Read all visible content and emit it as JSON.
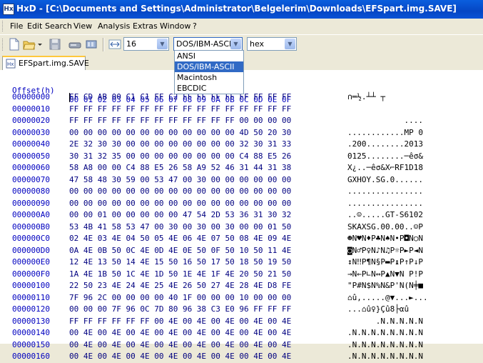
{
  "window": {
    "title": "HxD - [C:\\Documents and Settings\\Administrator\\Belgelerim\\Downloads\\EFSpart.img.SAVE]"
  },
  "menu": [
    "File",
    "Edit",
    "Search",
    "View",
    "Analysis",
    "Extras",
    "Window",
    "?"
  ],
  "toolbar": {
    "bytes_per_row": "16",
    "charset": "DOS/IBM-ASCII",
    "charset_options": [
      "ANSI",
      "DOS/IBM-ASCII",
      "Macintosh",
      "EBCDIC"
    ],
    "charset_selected_index": 1,
    "display_mode": "hex"
  },
  "tab": {
    "label": "EFSpart.img.SAVE"
  },
  "header": {
    "offset_label": "Offset(h)",
    "columns": "00 01 02 03 04 05 06 07 08 09 0A 0B 0C 0D 0E 0F"
  },
  "rows": [
    {
      "offset": "00000000",
      "hex": "EF CD AB 00 C1 C1 FF C2 FF FF FF FF FF FF FF FF",
      "ascii": "∩═½.┴┴ ┬"
    },
    {
      "offset": "00000010",
      "hex": "FF FF FF FF FF FF FF FF FF FF FF FF FF FF FF FF",
      "ascii": ""
    },
    {
      "offset": "00000020",
      "hex": "FF FF FF FF FF FF FF FF FF FF FF FF 00 00 00 00",
      "ascii": "            ...."
    },
    {
      "offset": "00000030",
      "hex": "00 00 00 00 00 00 00 00 00 00 00 00 4D 50 20 30",
      "ascii": "............MP 0"
    },
    {
      "offset": "00000040",
      "hex": "2E 32 30 30 00 00 00 00 00 00 00 00 32 30 31 33",
      "ascii": ".200........2013"
    },
    {
      "offset": "00000050",
      "hex": "30 31 32 35 00 00 00 00 00 00 00 00 C4 88 E5 26",
      "ascii": "0125........─êσ&"
    },
    {
      "offset": "00000060",
      "hex": "58 A8 00 00 C4 88 E5 26 58 A9 52 46 31 44 31 38",
      "ascii": "X¿..─êσ&X⌐RF1D18"
    },
    {
      "offset": "00000070",
      "hex": "47 58 48 30 59 00 53 47 00 30 00 00 00 00 00 00",
      "ascii": "GXHOY.SG.0......"
    },
    {
      "offset": "00000080",
      "hex": "00 00 00 00 00 00 00 00 00 00 00 00 00 00 00 00",
      "ascii": "................"
    },
    {
      "offset": "00000090",
      "hex": "00 00 00 00 00 00 00 00 00 00 00 00 00 00 00 00",
      "ascii": "................"
    },
    {
      "offset": "000000A0",
      "hex": "00 00 01 00 00 00 00 00 47 54 2D 53 36 31 30 32",
      "ascii": "..☺.....GT-S6102"
    },
    {
      "offset": "000000B0",
      "hex": "53 4B 41 58 53 47 00 30 00 30 00 30 00 00 01 50",
      "ascii": "SKAXSG.00.00..☺P"
    },
    {
      "offset": "000000C0",
      "hex": "02 4E 03 4E 04 50 05 4E 06 4E 07 50 08 4E 09 4E",
      "ascii": "☻N♥N♦P♣N♠N•P◘N○N"
    },
    {
      "offset": "000000D0",
      "hex": "0A 4E 0B 50 0C 4E 0D 4E 0E 50 0F 50 10 50 11 4E",
      "ascii": "◙N♂P♀N♪N♫P☼P►P◄N"
    },
    {
      "offset": "000000E0",
      "hex": "12 4E 13 50 14 4E 15 50 16 50 17 50 18 50 19 50",
      "ascii": "↕N‼P¶N§P▬P↨P↑P↓P"
    },
    {
      "offset": "000000F0",
      "hex": "1A 4E 1B 50 1C 4E 1D 50 1E 4E 1F 4E 20 50 21 50",
      "ascii": "→N←P∟N↔P▲N▼N P!P"
    },
    {
      "offset": "00000100",
      "hex": "22 50 23 4E 24 4E 25 4E 26 50 27 4E 28 4E D8 FE",
      "ascii": "\"P#N$N%N&P'N(N╪■"
    },
    {
      "offset": "00000110",
      "hex": "7F 96 2C 00 00 00 00 40 1F 00 00 00 10 00 00 00",
      "ascii": "⌂û,.....@▼...►..."
    },
    {
      "offset": "00000120",
      "hex": "00 00 00 7F 96 0C 7D 80 96 38 C3 E0 96 FF FF FF",
      "ascii": "...⌂û♀}Çû8├αû"
    },
    {
      "offset": "00000130",
      "hex": "FF FF FF FF FF FF 00 4E 00 4E 00 4E 00 4E 00 4E",
      "ascii": "      .N.N.N.N.N"
    },
    {
      "offset": "00000140",
      "hex": "00 4E 00 4E 00 4E 00 4E 00 4E 00 4E 00 4E 00 4E",
      "ascii": ".N.N.N.N.N.N.N.N"
    },
    {
      "offset": "00000150",
      "hex": "00 4E 00 4E 00 4E 00 4E 00 4E 00 4E 00 4E 00 4E",
      "ascii": ".N.N.N.N.N.N.N.N"
    },
    {
      "offset": "00000160",
      "hex": "00 4E 00 4E 00 4E 00 4E 00 4E 00 4E 00 4E 00 4E",
      "ascii": ".N.N.N.N.N.N.N.N"
    }
  ]
}
